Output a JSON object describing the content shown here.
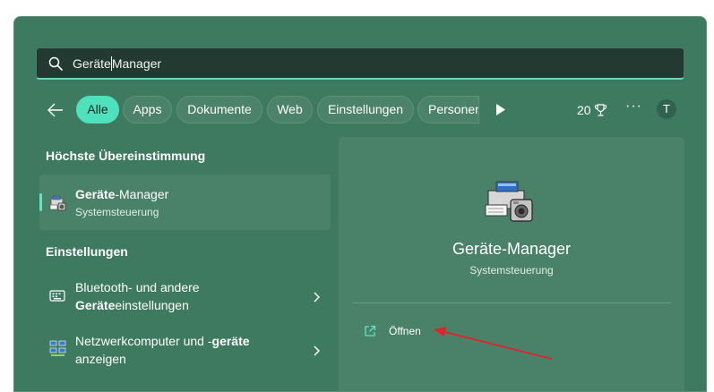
{
  "search": {
    "query_before_caret": "Geräte",
    "query_after_caret": "Manager"
  },
  "filters": {
    "chips": [
      {
        "label": "Alle",
        "active": true
      },
      {
        "label": "Apps",
        "active": false
      },
      {
        "label": "Dokumente",
        "active": false
      },
      {
        "label": "Web",
        "active": false
      },
      {
        "label": "Einstellungen",
        "active": false
      },
      {
        "label": "Personen",
        "active": false
      }
    ],
    "points": "20",
    "more": "···",
    "avatar_initial": "T"
  },
  "best_match": {
    "heading": "Höchste Übereinstimmung",
    "title_bold": "Geräte",
    "title_rest": "-Manager",
    "subtitle": "Systemsteuerung"
  },
  "settings": {
    "heading": "Einstellungen",
    "items": [
      {
        "line1": "Bluetooth- und andere",
        "line2_bold": "Geräte",
        "line2_rest": "einstellungen"
      },
      {
        "line1_rest": "Netzwerkcomputer und -",
        "line1_bold": "geräte",
        "line2": "anzeigen"
      }
    ]
  },
  "detail": {
    "name": "Geräte-Manager",
    "subtitle": "Systemsteuerung",
    "open_label": "Öffnen"
  },
  "colors": {
    "panel": "#3d7a5f",
    "accent": "#4fe0bd",
    "annotation_arrow": "#e0232a"
  },
  "icons": [
    "search-icon",
    "back-arrow-icon",
    "play-icon",
    "trophy-icon",
    "device-manager-icon",
    "keyboard-settings-icon",
    "network-icon",
    "chevron-right-icon",
    "open-external-icon"
  ]
}
